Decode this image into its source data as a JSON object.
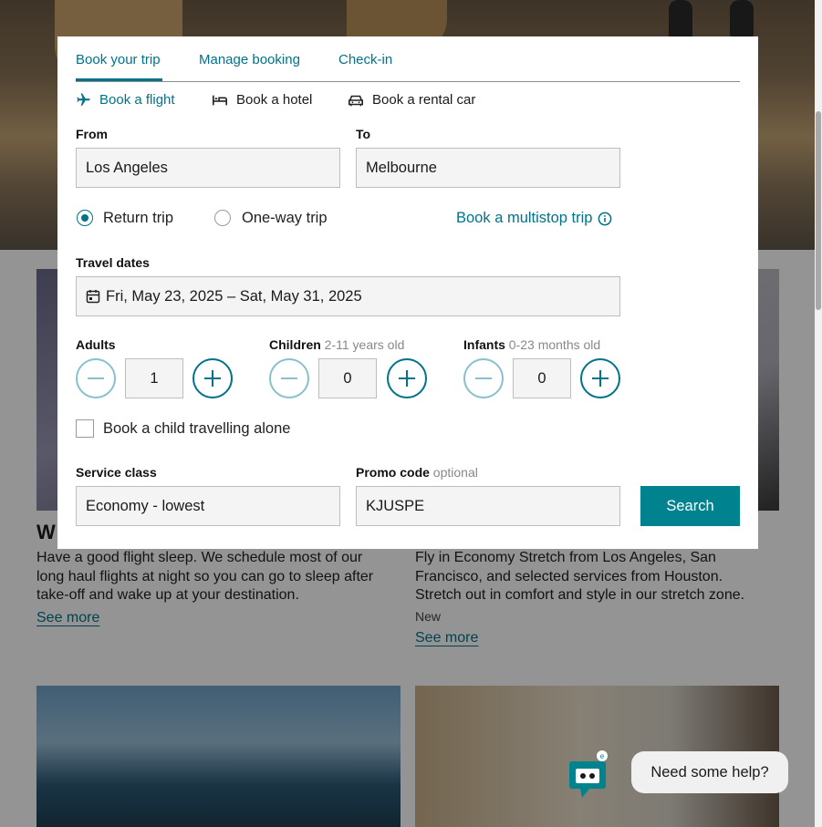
{
  "tabs": [
    {
      "label": "Book your trip"
    },
    {
      "label": "Manage booking"
    },
    {
      "label": "Check-in"
    }
  ],
  "subtabs": [
    {
      "label": "Book a flight",
      "icon": "airplane-icon"
    },
    {
      "label": "Book a hotel",
      "icon": "bed-icon"
    },
    {
      "label": "Book a rental car",
      "icon": "car-icon"
    }
  ],
  "from": {
    "label": "From",
    "value": "Los Angeles"
  },
  "to": {
    "label": "To",
    "value": "Melbourne"
  },
  "trip_type": {
    "return_label": "Return trip",
    "oneway_label": "One-way trip",
    "selected": "return"
  },
  "multistop_label": "Book a multistop trip",
  "dates": {
    "label": "Travel dates",
    "value": "Fri, May 23, 2025 – Sat, May 31, 2025"
  },
  "passengers": {
    "adults": {
      "label": "Adults",
      "hint": "",
      "value": "1"
    },
    "children": {
      "label": "Children",
      "hint": "2-11 years old",
      "value": "0"
    },
    "infants": {
      "label": "Infants",
      "hint": "0-23 months old",
      "value": "0"
    }
  },
  "child_alone_label": "Book a child travelling alone",
  "service_class": {
    "label": "Service class",
    "value": "Economy - lowest"
  },
  "promo": {
    "label": "Promo code",
    "hint": "optional",
    "value": "KJUSPE"
  },
  "search_label": "Search",
  "background": {
    "card1": {
      "title": "W",
      "text": [
        "Have a good flight sleep. We schedule most of our",
        "long haul flights at night so you can go to sleep after",
        "take-off and wake up at your destination."
      ],
      "link": "See more"
    },
    "card2": {
      "text": [
        "Fly in Economy Stretch from Los Angeles, San",
        "Francisco, and selected services from Houston.",
        "Stretch out in comfort and style in our stretch zone."
      ],
      "tag": "New",
      "link": "See more"
    }
  },
  "help": {
    "label": "Need some help?"
  },
  "colors": {
    "accent": "#00728a",
    "button": "#00828f"
  }
}
